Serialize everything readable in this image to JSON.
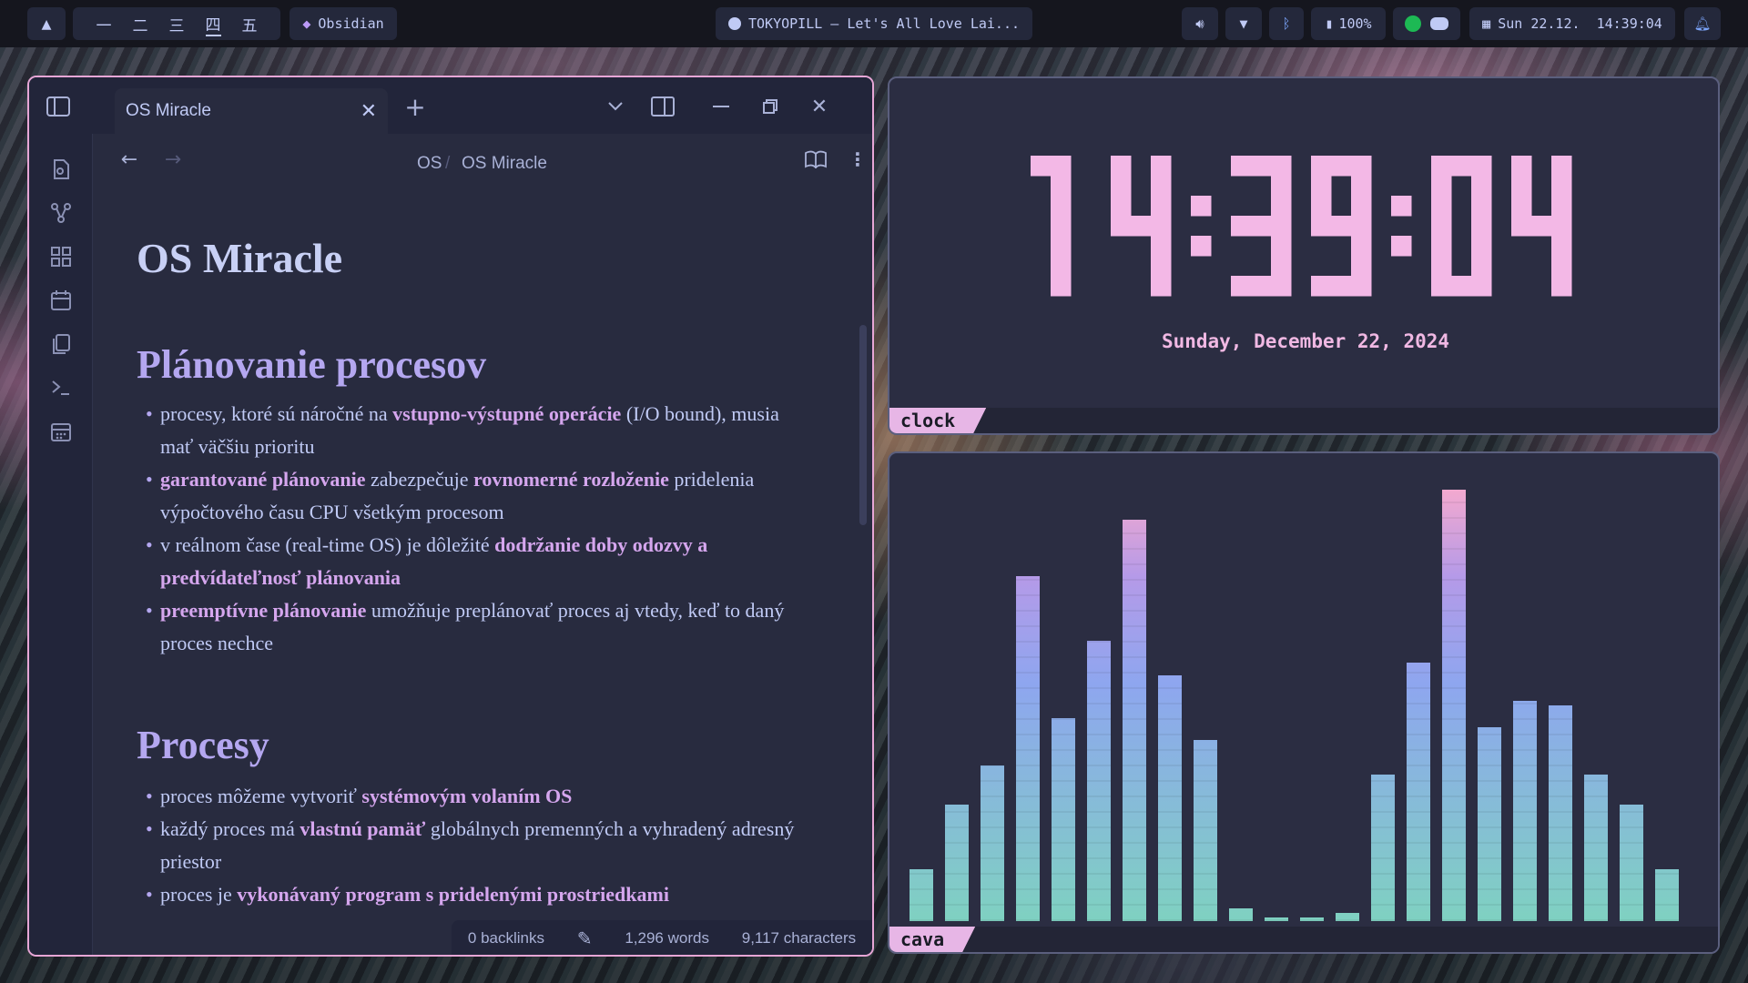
{
  "topbar": {
    "launcher_icon": "arch-icon",
    "workspaces": [
      "一",
      "二",
      "三",
      "四",
      "五"
    ],
    "active_workspace": 3,
    "active_app": "Obsidian",
    "media_title": "TOKYOPILL – Let's All Love Lai...",
    "battery": "100%",
    "datetime": "Sun 22.12.  14:39:04"
  },
  "obsidian": {
    "tab_title": "OS Miracle",
    "breadcrumb_parent": "OS",
    "breadcrumb_sep": "/",
    "breadcrumb_current": "OS Miracle",
    "doc_title": "OS Miracle",
    "section1_heading": "Plánovanie procesov",
    "section2_heading": "Procesy",
    "status": {
      "backlinks": "0 backlinks",
      "words": "1,296 words",
      "characters": "9,117 characters"
    }
  },
  "section1_items": [
    [
      {
        "t": "procesy, ktoré sú náročné na "
      },
      {
        "t": "vstupno-výstupné operácie",
        "h": 1
      },
      {
        "t": " (I/O bound), musia mať väčšiu prioritu"
      }
    ],
    [
      {
        "t": "garantované plánovanie",
        "h": 1
      },
      {
        "t": " zabezpečuje "
      },
      {
        "t": "rovnomerné rozloženie",
        "h": 1
      },
      {
        "t": " pridelenia výpočtového času CPU všetkým procesom"
      }
    ],
    [
      {
        "t": "v reálnom čase (real-time OS) je dôležité "
      },
      {
        "t": "dodržanie doby odozvy a predvídateľnosť plánovania",
        "h": 1
      }
    ],
    [
      {
        "t": "preemptívne plánovanie",
        "h": 1
      },
      {
        "t": " umožňuje preplánovať proces aj vtedy, keď to daný proces nechce"
      }
    ]
  ],
  "section2_items": [
    [
      {
        "t": "proces môžeme vytvoriť "
      },
      {
        "t": "systémovým volaním OS",
        "h": 1
      }
    ],
    [
      {
        "t": "každý proces má "
      },
      {
        "t": "vlastnú pamäť",
        "h": 1
      },
      {
        "t": " globálnych premenných a vyhradený adresný priestor"
      }
    ],
    [
      {
        "t": "proces je "
      },
      {
        "t": "vykonávaný program s pridelenými prostriedkami",
        "h": 1
      }
    ]
  ],
  "clock": {
    "time": "14:39:04",
    "date": "Sunday, December 22, 2024",
    "label": "clock"
  },
  "cava": {
    "label": "cava",
    "levels": [
      0.12,
      0.27,
      0.36,
      0.8,
      0.47,
      0.65,
      0.93,
      0.57,
      0.42,
      0.03,
      0.005,
      0.005,
      0.02,
      0.34,
      0.6,
      1.0,
      0.45,
      0.51,
      0.5,
      0.34,
      0.27,
      0.12
    ]
  },
  "colors": {
    "accent_pink": "#e7a6d6",
    "highlight": "#d5a6ee",
    "clock_pink": "#f3b8e6",
    "cava_bottom": "#7fd1c1",
    "cava_mid": "#8ea6ef",
    "cava_top": "#f3a9cf"
  }
}
